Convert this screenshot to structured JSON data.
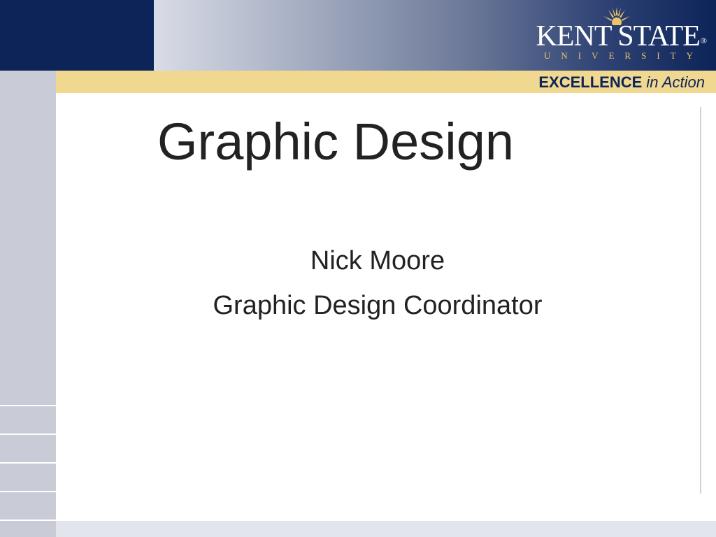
{
  "header": {
    "logo_name": "KENT STATE",
    "logo_registered": "®",
    "logo_sub": "UNIVERSITY",
    "tagline_strong": "EXCELLENCE",
    "tagline_em": "in Action"
  },
  "slide": {
    "title": "Graphic Design",
    "author": "Nick Moore",
    "role": "Graphic Design Coordinator"
  },
  "colors": {
    "navy": "#0d2459",
    "gold": "#e8c567",
    "tagline_band": "#f1d890",
    "side_panel": "#c9ccd6"
  }
}
